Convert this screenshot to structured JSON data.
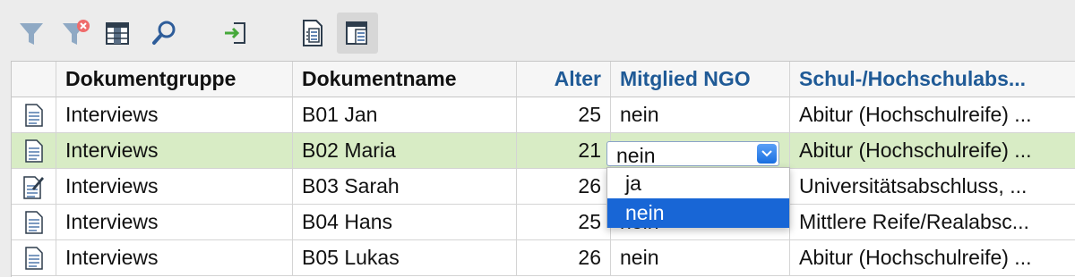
{
  "toolbar": {
    "buttons": [
      {
        "name": "filter-icon"
      },
      {
        "name": "filter-remove-icon"
      },
      {
        "name": "columns-icon"
      },
      {
        "name": "search-icon"
      },
      {
        "name": "import-icon"
      },
      {
        "name": "document-list-icon"
      },
      {
        "name": "document-table-icon",
        "active": true
      }
    ]
  },
  "table": {
    "columns": [
      "Dokumentgruppe",
      "Dokumentname",
      "Alter",
      "Mitglied NGO",
      "Schul-/Hochschulabs..."
    ],
    "rows": [
      {
        "icon": "document-icon",
        "group": "Interviews",
        "name": "B01 Jan",
        "age": "25",
        "ngo": "nein",
        "school": "Abitur (Hochschulreife) ..."
      },
      {
        "icon": "document-icon",
        "group": "Interviews",
        "name": "B02 Maria",
        "age": "21",
        "ngo": "",
        "school": "Abitur (Hochschulreife) ...",
        "selected": true
      },
      {
        "icon": "document-edit-icon",
        "group": "Interviews",
        "name": "B03 Sarah",
        "age": "26",
        "ngo": "",
        "school": "Universitätsabschluss, ..."
      },
      {
        "icon": "document-icon",
        "group": "Interviews",
        "name": "B04 Hans",
        "age": "25",
        "ngo": "nein",
        "school": "Mittlere Reife/Realabsc..."
      },
      {
        "icon": "document-icon",
        "group": "Interviews",
        "name": "B05 Lukas",
        "age": "26",
        "ngo": "nein",
        "school": "Abitur (Hochschulreife) ..."
      }
    ]
  },
  "dropdown": {
    "value": "nein",
    "options": [
      "ja",
      "nein"
    ],
    "highlighted": "nein"
  },
  "colors": {
    "header_blue": "#1f5a96",
    "selected_row": "#d8ecc5",
    "menu_highlight": "#1866d6"
  }
}
